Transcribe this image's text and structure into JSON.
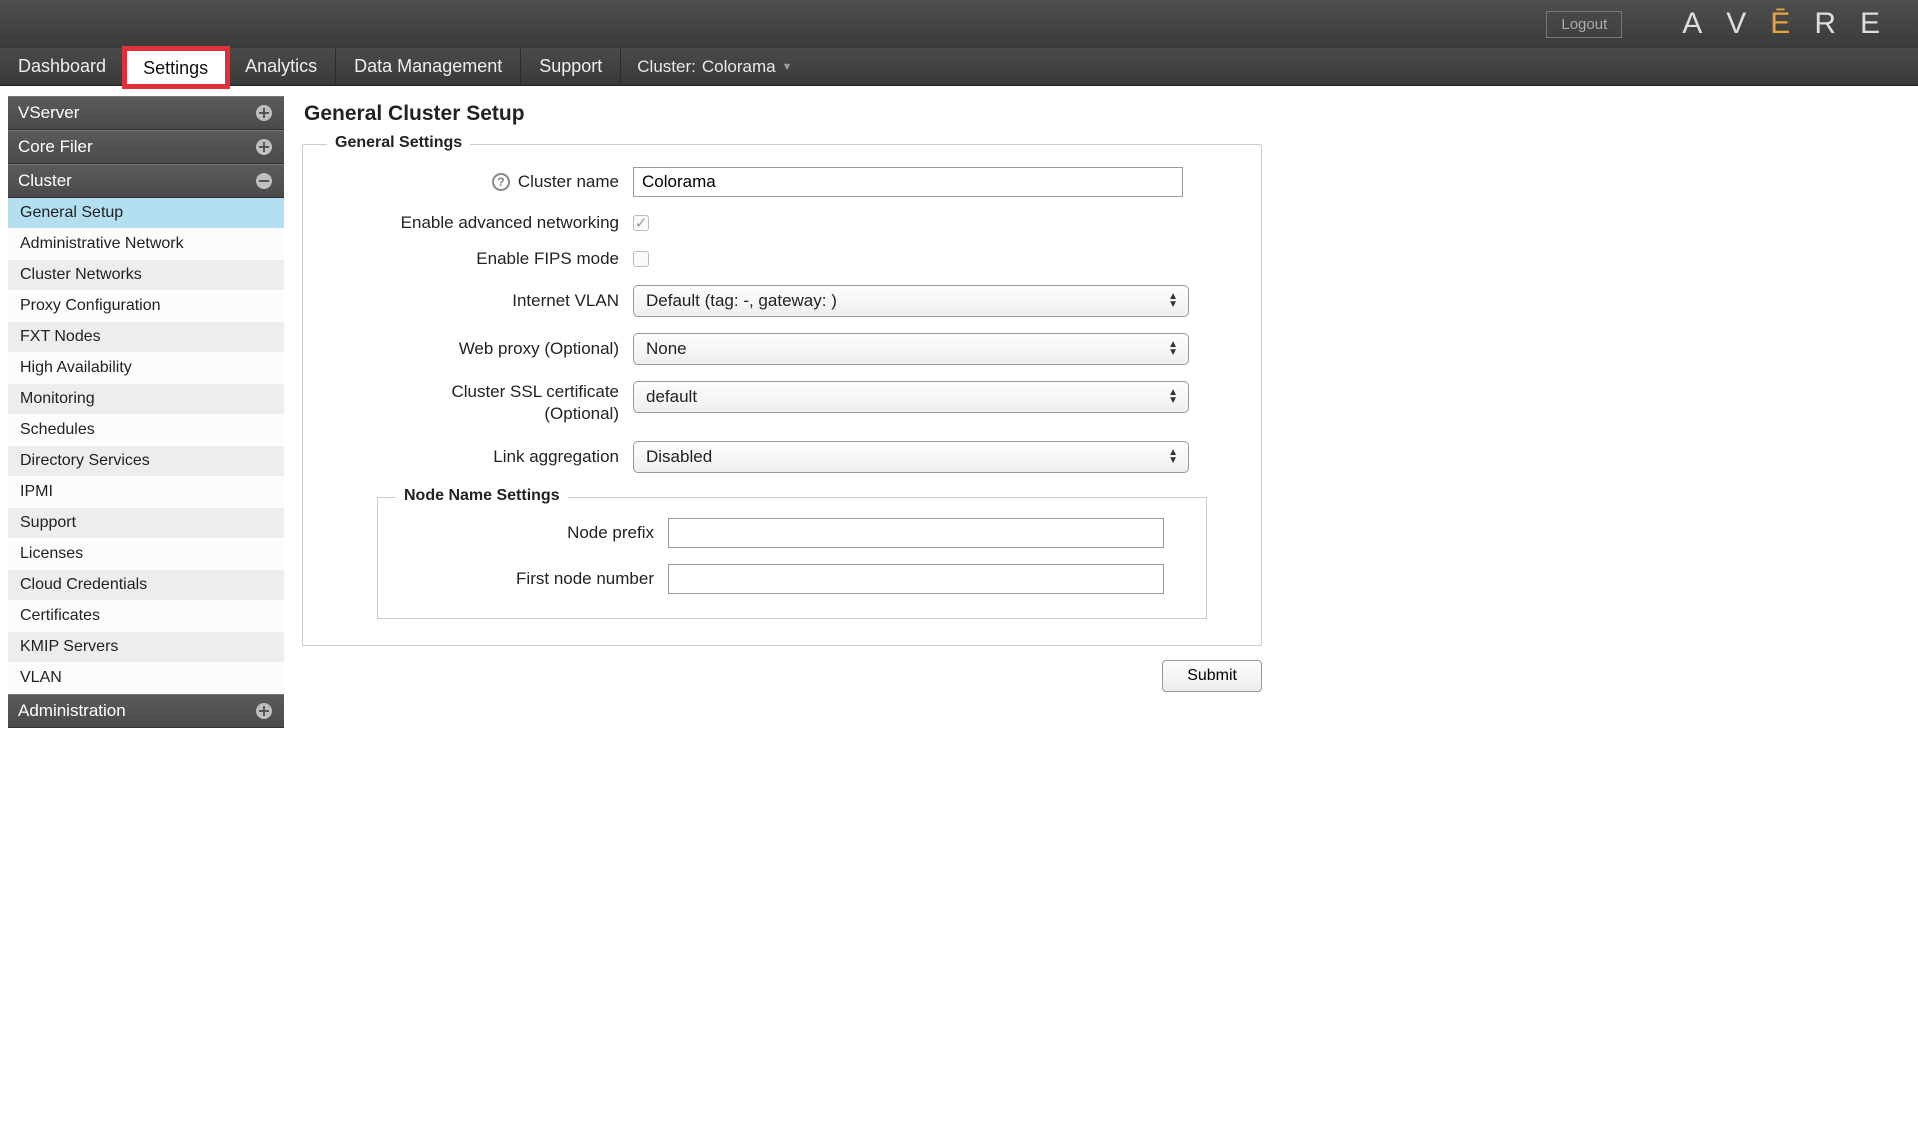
{
  "header": {
    "logout_label": "Logout",
    "logo_text": "AVERE"
  },
  "tabs": [
    "Dashboard",
    "Settings",
    "Analytics",
    "Data Management",
    "Support"
  ],
  "active_tab_index": 1,
  "cluster_indicator": {
    "prefix": "Cluster:",
    "name": "Colorama"
  },
  "sidebar": {
    "sections": [
      {
        "label": "VServer",
        "expanded": false,
        "items": []
      },
      {
        "label": "Core Filer",
        "expanded": false,
        "items": []
      },
      {
        "label": "Cluster",
        "expanded": true,
        "items": [
          "General Setup",
          "Administrative Network",
          "Cluster Networks",
          "Proxy Configuration",
          "FXT Nodes",
          "High Availability",
          "Monitoring",
          "Schedules",
          "Directory Services",
          "IPMI",
          "Support",
          "Licenses",
          "Cloud Credentials",
          "Certificates",
          "KMIP Servers",
          "VLAN"
        ],
        "selected_index": 0
      },
      {
        "label": "Administration",
        "expanded": false,
        "items": []
      }
    ]
  },
  "page": {
    "title": "General Cluster Setup",
    "general_settings_legend": "General Settings",
    "node_name_settings_legend": "Node Name Settings",
    "fields": {
      "cluster_name": {
        "label": "Cluster name",
        "value": "Colorama"
      },
      "enable_adv_net": {
        "label": "Enable advanced networking",
        "checked": true
      },
      "enable_fips": {
        "label": "Enable FIPS mode",
        "checked": false
      },
      "internet_vlan": {
        "label": "Internet VLAN",
        "value": "Default (tag: -, gateway:               )"
      },
      "web_proxy": {
        "label": "Web proxy (Optional)",
        "value": "None"
      },
      "ssl_cert": {
        "label": "Cluster SSL certificate (Optional)",
        "value": "default"
      },
      "link_agg": {
        "label": "Link aggregation",
        "value": "Disabled"
      },
      "node_prefix": {
        "label": "Node prefix",
        "value": ""
      },
      "first_node_number": {
        "label": "First node number",
        "value": ""
      }
    },
    "submit_label": "Submit"
  }
}
